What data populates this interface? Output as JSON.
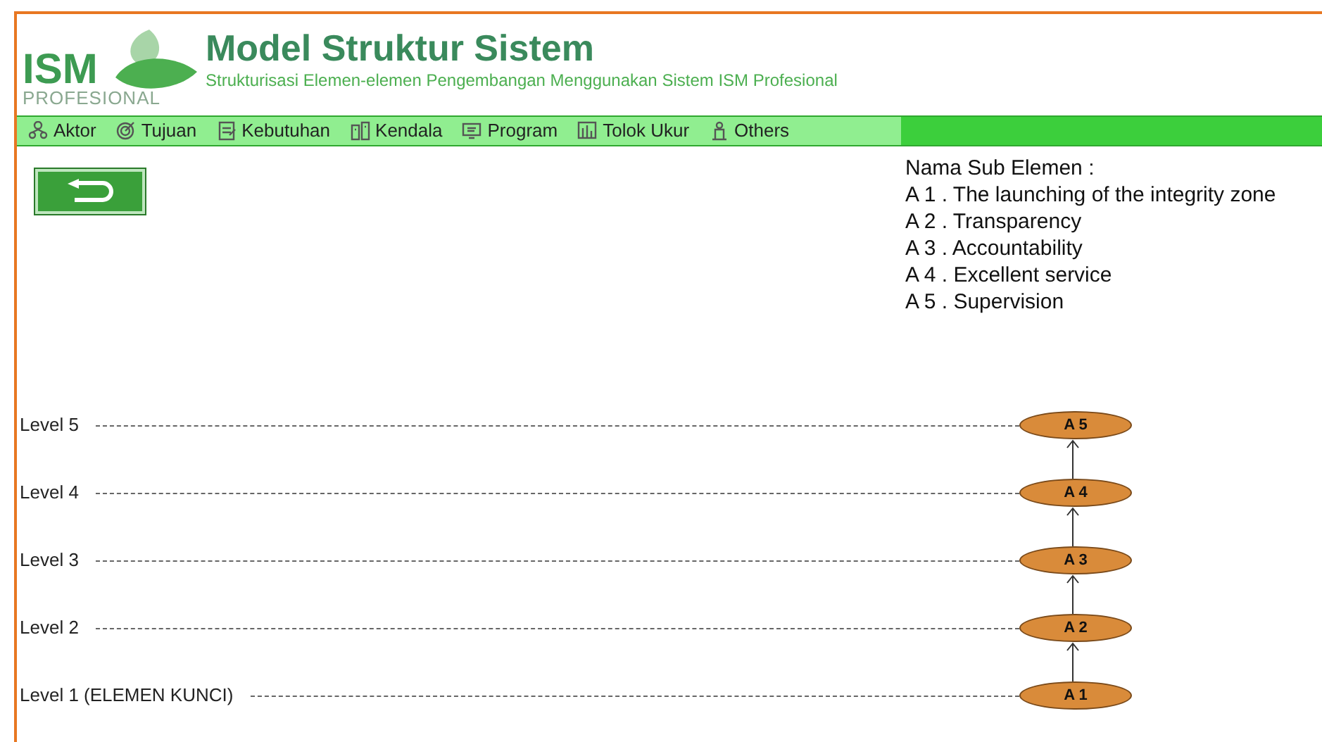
{
  "header": {
    "logo_text": "ISM",
    "logo_subtext": "PROFESIONAL",
    "title": "Model Struktur Sistem",
    "subtitle": "Strukturisasi Elemen-elemen Pengembangan Menggunakan Sistem ISM Profesional"
  },
  "menu": [
    {
      "label": "Aktor"
    },
    {
      "label": "Tujuan"
    },
    {
      "label": "Kebutuhan"
    },
    {
      "label": "Kendala"
    },
    {
      "label": "Program"
    },
    {
      "label": "Tolok Ukur"
    },
    {
      "label": "Others"
    }
  ],
  "sub_elements": {
    "heading": "Nama Sub Elemen :",
    "items": [
      "A 1 . The launching of the integrity zone",
      "A 2 . Transparency",
      "A 3 . Accountability",
      "A 4 . Excellent service",
      "A 5 . Supervision"
    ]
  },
  "levels": [
    {
      "label": "Level 5",
      "node": "A 5"
    },
    {
      "label": "Level 4",
      "node": "A 4"
    },
    {
      "label": "Level 3",
      "node": "A 3"
    },
    {
      "label": "Level 2",
      "node": "A 2"
    },
    {
      "label": "Level 1 (ELEMEN KUNCI)",
      "node": "A 1"
    }
  ]
}
